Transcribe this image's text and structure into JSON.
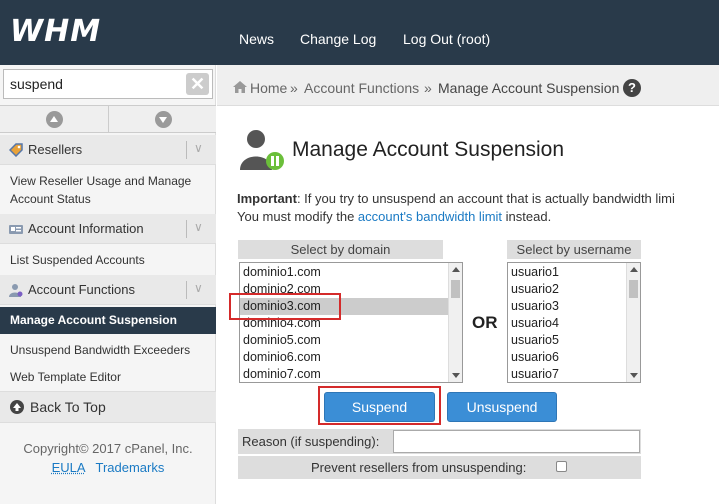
{
  "header": {
    "logo": "WHM",
    "nav": [
      "News",
      "Change Log",
      "Log Out (root)"
    ]
  },
  "sidebar": {
    "search": {
      "value": "suspend",
      "placeholder": ""
    },
    "categories": [
      {
        "label": "Resellers",
        "icon": "tag-icon",
        "items": [
          "View Reseller Usage and Manage Account Status"
        ]
      },
      {
        "label": "Account Information",
        "icon": "id-card-icon",
        "items": [
          "List Suspended Accounts"
        ]
      },
      {
        "label": "Account Functions",
        "icon": "user-icon",
        "items": [
          "Manage Account Suspension",
          "Unsuspend Bandwidth Exceeders",
          "Web Template Editor"
        ]
      }
    ],
    "active_item": "Manage Account Suspension",
    "back_to_top": "Back To Top",
    "copyright": "Copyright© 2017 cPanel, Inc.",
    "footer_links": [
      "EULA",
      "Trademarks"
    ]
  },
  "breadcrumb": {
    "home": "Home",
    "sep": "»",
    "items": [
      "Account Functions",
      "Manage Account Suspension"
    ],
    "help": "?"
  },
  "main": {
    "title": "Manage Account Suspension",
    "important_label": "Important",
    "important_text_1": ": If you try to unsuspend an account that is actually bandwidth limi",
    "important_text_2": "You must modify the ",
    "important_link": "account's bandwidth limit",
    "important_text_3": " instead.",
    "domain_header": "Select by domain",
    "domains": [
      "dominio1.com",
      "dominio2.com",
      "dominio3.com",
      "dominio4.com",
      "dominio5.com",
      "dominio6.com",
      "dominio7.com"
    ],
    "selected_domain": "dominio3.com",
    "or_label": "OR",
    "username_header": "Select by username",
    "usernames": [
      "usuario1",
      "usuario2",
      "usuario3",
      "usuario4",
      "usuario5",
      "usuario6",
      "usuario7"
    ],
    "suspend_button": "Suspend",
    "unsuspend_button": "Unsuspend",
    "reason_label": "Reason (if suspending):",
    "reason_value": "",
    "prevent_label": "Prevent resellers from unsuspending:",
    "prevent_checked": false
  },
  "colors": {
    "header_bg": "#293a4a",
    "button_blue": "#3b8ed6",
    "link_blue": "#1a7ac4",
    "highlight_red": "#d42a2a"
  }
}
